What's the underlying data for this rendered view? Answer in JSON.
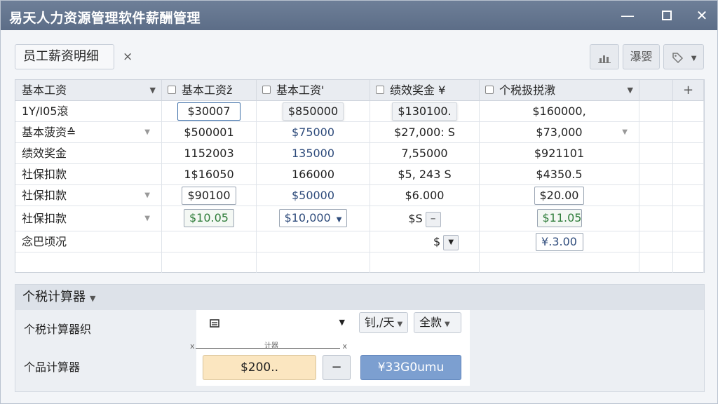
{
  "window": {
    "title": "易天人力资源管理软件薪酬管理"
  },
  "titlebar": {
    "minimize": "—",
    "close": "✕"
  },
  "tab": {
    "label": "员工薪资明细",
    "close": "×"
  },
  "toolbar": {
    "btn1_icon": "bar-chart-icon",
    "btn2_label": "瀑婴",
    "btn3_icon": "tag-icon"
  },
  "grid": {
    "headers": [
      "基本工资",
      "基本工资ž",
      "基本工资'",
      "绩效奖金 ¥",
      "个税扱捝漖"
    ],
    "add": "+",
    "rows": [
      {
        "label": "1Y/I05滾",
        "c2": "$30007",
        "c3": "$850000",
        "c4": "$130100.",
        "c5": "$160000,"
      },
      {
        "label": "基本菠资≙",
        "c2": "$500001",
        "c3": "$75000",
        "c4": "$27,000: S",
        "c5": "$73,000"
      },
      {
        "label": "绩效奖金",
        "c2": "1152003",
        "c3": "135000",
        "c4": "7,55000",
        "c5": "$921101"
      },
      {
        "label": "社保扣款",
        "c2": "1$16050",
        "c3": "166000",
        "c4": "$5, 243 S",
        "c5": "$4350.5"
      },
      {
        "label": "社保扣款",
        "c2": "$90100",
        "c3": "$50000",
        "c4": "$6.000",
        "c5": "$20.00"
      },
      {
        "label": "社保扣款",
        "c2": "$10.05",
        "c3": "$10,000",
        "c4": "$S",
        "c5": "$11.05"
      },
      {
        "label": "念巴顷况",
        "c2": "",
        "c3": "",
        "c4": "$",
        "c5": "¥.3.00"
      }
    ]
  },
  "panel": {
    "title": "个税计算器",
    "label1": "个税计算器织",
    "label2": "个品计算器",
    "select_icon": "document-icon",
    "select2": "钊,/天",
    "select3": "全款",
    "scale_left": "x",
    "scale_label": "计器",
    "scale_right": "x",
    "amount": "$200..",
    "minus": "−",
    "result": "¥33G0umu"
  },
  "colors": {
    "titlebar": "#617290",
    "amount_bg": "#fbe6c0",
    "result_bg": "#7c9fd0",
    "green_text": "#2f7d3a"
  }
}
